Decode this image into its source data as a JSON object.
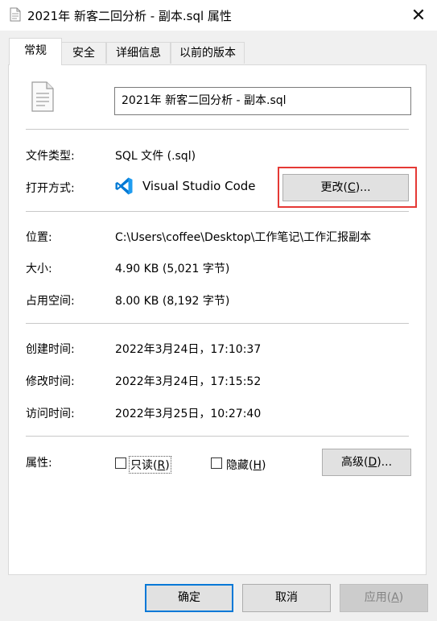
{
  "window": {
    "title": "2021年 新客二回分析 - 副本.sql 属性",
    "close_glyph": "✕"
  },
  "tabs": [
    {
      "label": "常规"
    },
    {
      "label": "安全"
    },
    {
      "label": "详细信息"
    },
    {
      "label": "以前的版本"
    }
  ],
  "general": {
    "file_name": "2021年 新客二回分析 - 副本.sql",
    "file_type_label": "文件类型:",
    "file_type_value": "SQL 文件 (.sql)",
    "open_with_label": "打开方式:",
    "open_with_app": "Visual Studio Code",
    "change_button": {
      "text": "更改(",
      "key": "C",
      "suffix": ")..."
    },
    "location_label": "位置:",
    "location_value": "C:\\Users\\coffee\\Desktop\\工作笔记\\工作汇报副本",
    "size_label": "大小:",
    "size_value": "4.90 KB (5,021 字节)",
    "size_on_disk_label": "占用空间:",
    "size_on_disk_value": "8.00 KB (8,192 字节)",
    "created_label": "创建时间:",
    "created_value": "2022年3月24日，17:10:37",
    "modified_label": "修改时间:",
    "modified_value": "2022年3月24日，17:15:52",
    "accessed_label": "访问时间:",
    "accessed_value": "2022年3月25日，10:27:40",
    "attributes_label": "属性:",
    "readonly": {
      "text": "只读(",
      "key": "R",
      "suffix": ")",
      "checked": false
    },
    "hidden": {
      "text": "隐藏(",
      "key": "H",
      "suffix": ")",
      "checked": false
    },
    "advanced_button": {
      "text": "高级(",
      "key": "D",
      "suffix": ")..."
    }
  },
  "footer": {
    "ok": "确定",
    "cancel": "取消",
    "apply": {
      "text": "应用(",
      "key": "A",
      "suffix": ")"
    }
  },
  "colors": {
    "highlight": "#e53935",
    "vscode_blue": "#0078d4",
    "ok_border": "#0078d7"
  }
}
